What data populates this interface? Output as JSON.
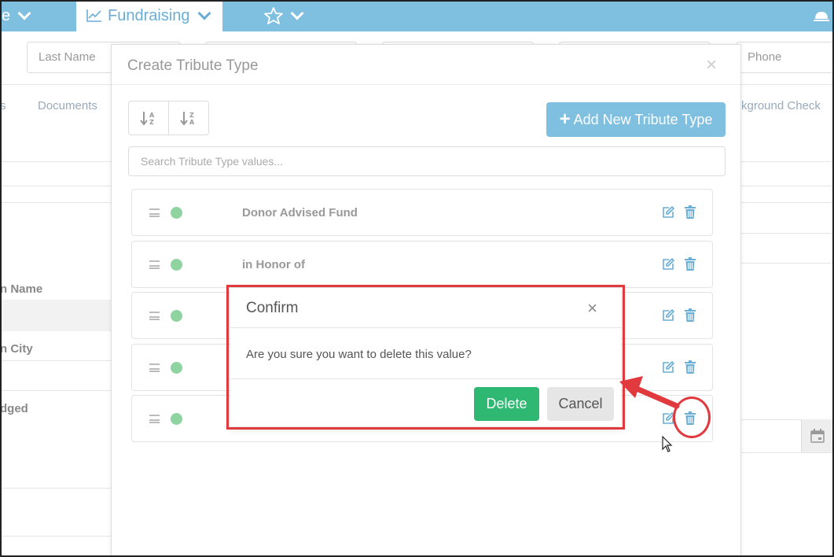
{
  "topnav": {
    "left_fragment": "e",
    "fundraising_label": "Fundraising",
    "colors": {
      "bar": "#7fbfe0",
      "active_text": "#6aaed6"
    }
  },
  "background_page": {
    "last_name_placeholder": "Last Name",
    "phone_placeholder": "Phone",
    "tab_fragment_left": "s",
    "documents_tab": "Documents",
    "background_check_tab": "kground Check",
    "label_name": "n Name",
    "label_city": "n City",
    "label_pledged": "dged"
  },
  "tribute_modal": {
    "title": "Create Tribute Type",
    "close_glyph": "×",
    "sort_asc_label": "A-Z",
    "sort_desc_label": "Z-A",
    "add_button_plus": "+",
    "add_button_label": "Add New Tribute Type",
    "search_placeholder": "Search Tribute Type values...",
    "rows": [
      {
        "value": "Donor Advised Fund",
        "active": true
      },
      {
        "value": "in Honor of",
        "active": true
      },
      {
        "value": "",
        "active": true
      },
      {
        "value": "",
        "active": true
      },
      {
        "value": "",
        "active": true
      }
    ],
    "icons": {
      "drag": "drag-handle-icon",
      "status": "status-dot",
      "edit": "edit-icon",
      "delete": "trash-icon"
    },
    "colors": {
      "accent": "#7fbfe0",
      "status_dot": "#8fd3a1",
      "icon": "#6aaed6"
    }
  },
  "confirm_dialog": {
    "title": "Confirm",
    "close_glyph": "×",
    "message": "Are you sure you want to delete this value?",
    "delete_label": "Delete",
    "cancel_label": "Cancel",
    "colors": {
      "delete": "#2eb872",
      "cancel": "#e6e6e6"
    }
  },
  "annotation": {
    "color": "#e03a3e"
  }
}
